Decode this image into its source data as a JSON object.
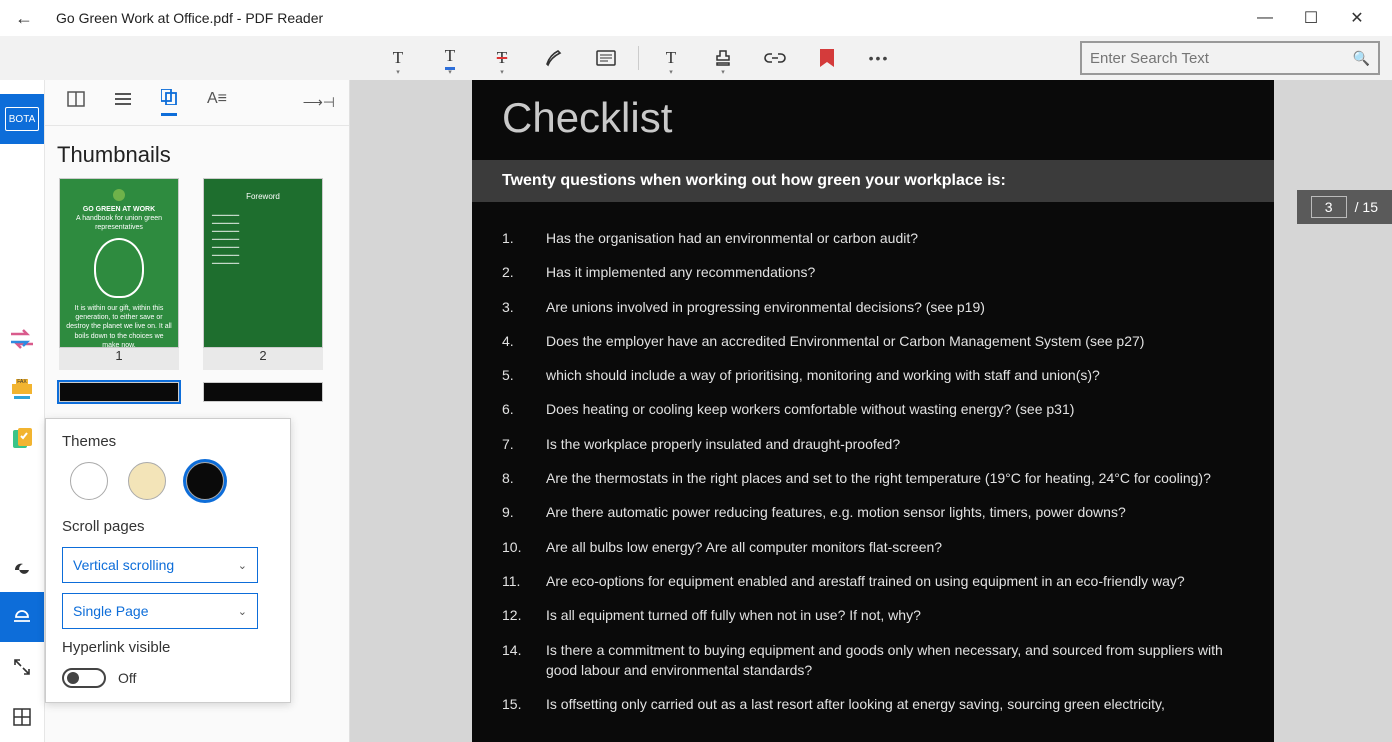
{
  "window": {
    "title": "Go Green Work at Office.pdf - PDF Reader"
  },
  "search": {
    "placeholder": "Enter Search Text"
  },
  "rail": {
    "bota": "BOTA"
  },
  "sidepanel": {
    "title": "Thumbnails",
    "thumbs": {
      "p1": "1",
      "p2": "2",
      "t1_title": "GO GREEN AT WORK",
      "t1_sub": "A handbook for union green representatives",
      "t1_foot": "It is within our gift, within this generation, to either save or destroy the planet we live on. It all boils down to the choices we make now.",
      "t2_title": "Foreword"
    }
  },
  "popup": {
    "themes_label": "Themes",
    "scroll_label": "Scroll pages",
    "sel1": "Vertical scrolling",
    "sel2": "Single Page",
    "hyper_label": "Hyperlink visible",
    "off": "Off"
  },
  "page": {
    "title": "Checklist",
    "band": "Twenty questions when working out how green your workplace is:",
    "q": {
      "1": {
        "n": "1.",
        "t": "Has the organisation had an environmental or carbon audit?"
      },
      "2": {
        "n": "2.",
        "t": "Has it implemented any recommendations?"
      },
      "3": {
        "n": "3.",
        "t": "Are unions involved in progressing environmental decisions? (see p19)"
      },
      "4": {
        "n": "4.",
        "t": " Does the employer have an accredited Environmental or Carbon Management System (see p27)"
      },
      "5": {
        "n": "5.",
        "t": "which should include a way of prioritising, monitoring and working with staff and union(s)?"
      },
      "6": {
        "n": "6.",
        "t": "Does heating or cooling keep workers comfortable without wasting energy? (see p31)"
      },
      "7": {
        "n": "7.",
        "t": "Is the workplace properly insulated and draught-proofed?"
      },
      "8": {
        "n": "8.",
        "t": " Are the thermostats in the right places and set to the right temperature (19°C for heating, 24°C for cooling)?"
      },
      "9": {
        "n": "9.",
        "t": "Are there automatic power reducing features, e.g. motion sensor lights, timers, power downs?"
      },
      "10": {
        "n": "10.",
        "t": " Are all bulbs low energy? Are all computer monitors flat-screen?"
      },
      "11": {
        "n": "11.",
        "t": " Are eco-options for equipment enabled and arestaff trained on using equipment in an eco-friendly way?"
      },
      "12": {
        "n": "12.",
        "t": " Is all equipment turned off fully when not in use? If not, why?"
      },
      "13": {
        "n": "14.",
        "t": " Is there a commitment to buying equipment and goods only when necessary, and sourced from suppliers with good labour and environmental standards?"
      },
      "14": {
        "n": "15.",
        "t": " Is offsetting only carried out as a last resort after looking at energy saving, sourcing green electricity,"
      }
    }
  },
  "pager": {
    "cur": "3",
    "total": "/ 15"
  }
}
